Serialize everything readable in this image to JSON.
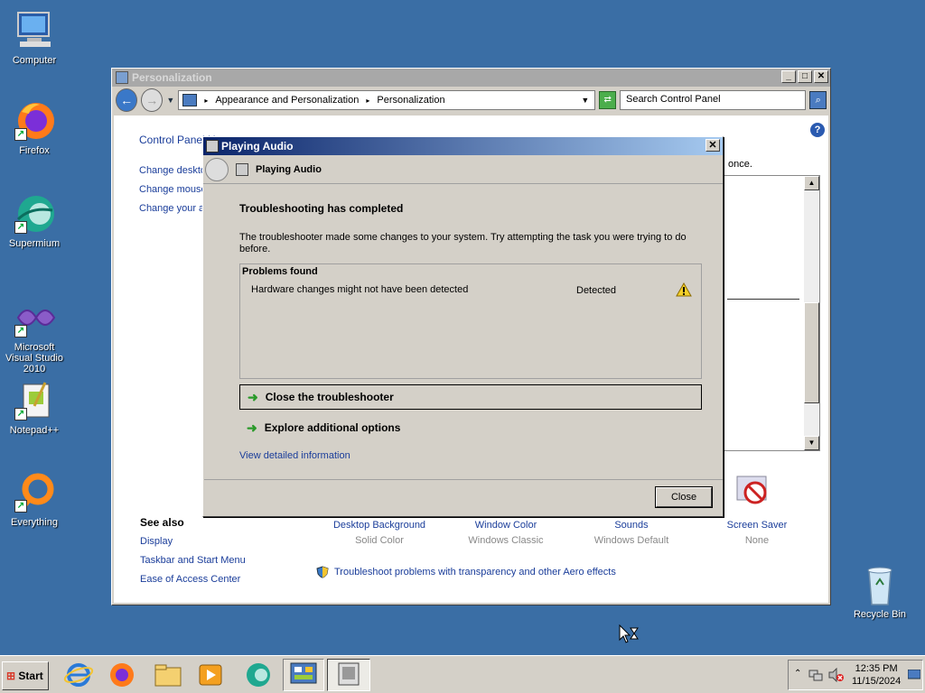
{
  "desktop": {
    "icons": [
      {
        "label": "Computer"
      },
      {
        "label": "Firefox"
      },
      {
        "label": "Supermium"
      },
      {
        "label": "Microsoft Visual Studio 2010"
      },
      {
        "label": "Notepad++"
      },
      {
        "label": "Everything"
      },
      {
        "label": "Recycle Bin"
      }
    ]
  },
  "cp": {
    "title": "Personalization",
    "breadcrumb": [
      "Appearance and Personalization",
      "Personalization"
    ],
    "search_placeholder": "Search Control Panel",
    "left_links": [
      "Control Panel H",
      "Change desktop",
      "Change mouse",
      "Change your a"
    ],
    "behind_text": "once.",
    "see_also_title": "See also",
    "see_also": [
      "Display",
      "Taskbar and Start Menu",
      "Ease of Access Center"
    ],
    "settings": [
      {
        "title": "Desktop Background",
        "value": "Solid Color"
      },
      {
        "title": "Window Color",
        "value": "Windows Classic"
      },
      {
        "title": "Sounds",
        "value": "Windows Default"
      },
      {
        "title": "Screen Saver",
        "value": "None"
      }
    ],
    "troubleshoot_link": "Troubleshoot problems with transparency and other Aero effects"
  },
  "dialog": {
    "title": "Playing Audio",
    "header": "Playing Audio",
    "heading": "Troubleshooting has completed",
    "description": "The troubleshooter made some changes to your system. Try attempting the task you were trying to do before.",
    "problems_title": "Problems found",
    "problem_text": "Hardware changes might not have been detected",
    "problem_status": "Detected",
    "cmd_close": "Close the troubleshooter",
    "cmd_explore": "Explore additional options",
    "view_detail": "View detailed information",
    "close_button": "Close"
  },
  "taskbar": {
    "start": "Start",
    "time": "12:35 PM",
    "date": "11/15/2024"
  },
  "colors": {
    "desktop": "#3a6ea5",
    "link": "#1a3d9a",
    "title_active": "#0a246a",
    "title_inactive": "#a8a8a8"
  }
}
